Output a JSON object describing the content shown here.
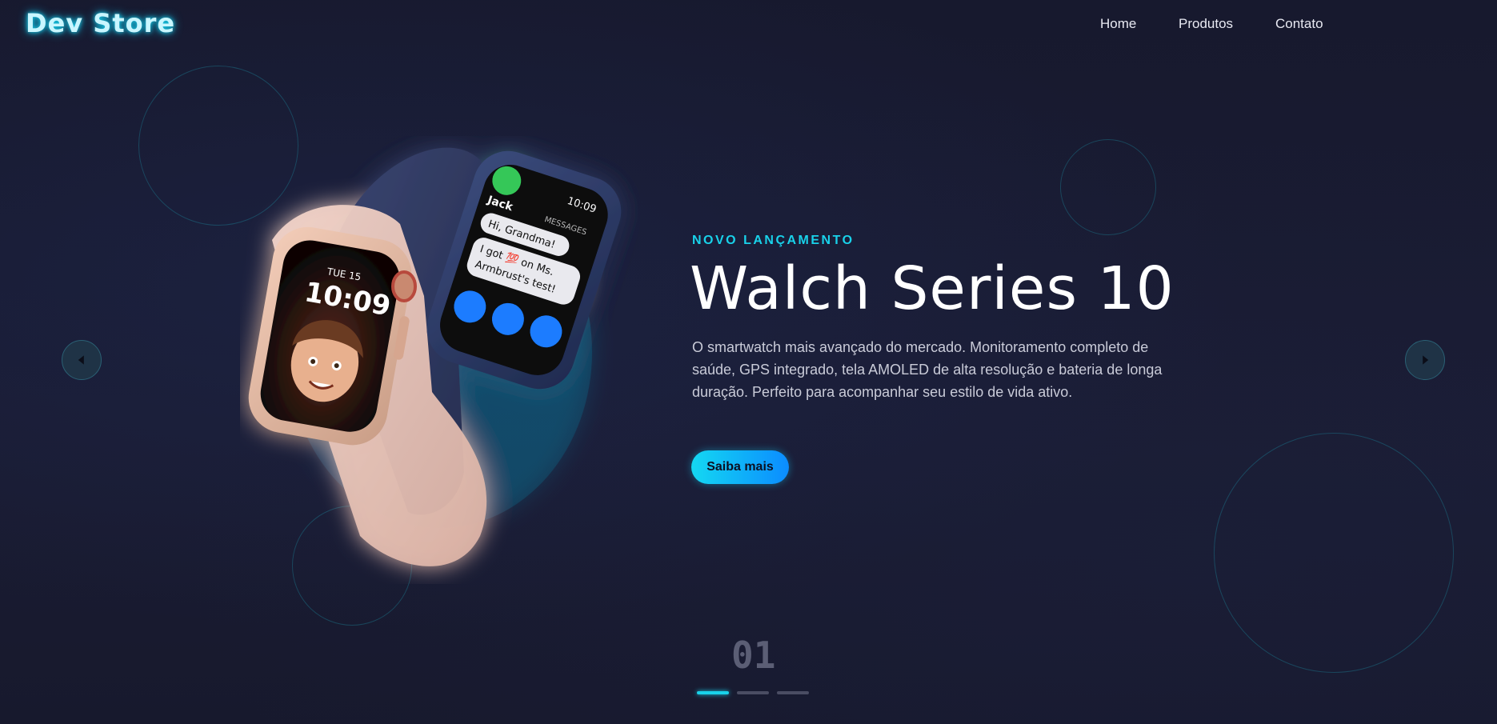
{
  "header": {
    "logo": "Dev Store",
    "nav": [
      {
        "label": "Home"
      },
      {
        "label": "Produtos"
      },
      {
        "label": "Contato"
      }
    ]
  },
  "hero": {
    "eyebrow": "NOVO LANÇAMENTO",
    "title": "Walch Series 10",
    "description": "O smartwatch mais avançado do mercado. Monitoramento completo de saúde, GPS integrado, tela AMOLED de alta resolução e bateria de longa duração. Perfeito para acompanhar seu estilo de vida ativo.",
    "cta_label": "Saiba mais"
  },
  "watch_screens": {
    "front": {
      "date": "TUE 15",
      "time": "10:09"
    },
    "back": {
      "time": "10:09",
      "sender": "Jack",
      "app": "MESSAGES",
      "message_1": "Hi, Grandma!",
      "message_2": "I got 💯 on Ms.",
      "message_3": "Armbrust's test!"
    }
  },
  "carousel": {
    "slide_number": "01",
    "total_dots": 3,
    "active_index": 0,
    "prev_icon": "caret-left-icon",
    "next_icon": "caret-right-icon"
  },
  "colors": {
    "accent": "#19d2ea",
    "background": "#15172b",
    "cta_gradient_start": "#14d8f2",
    "cta_gradient_end": "#0b8cff"
  }
}
